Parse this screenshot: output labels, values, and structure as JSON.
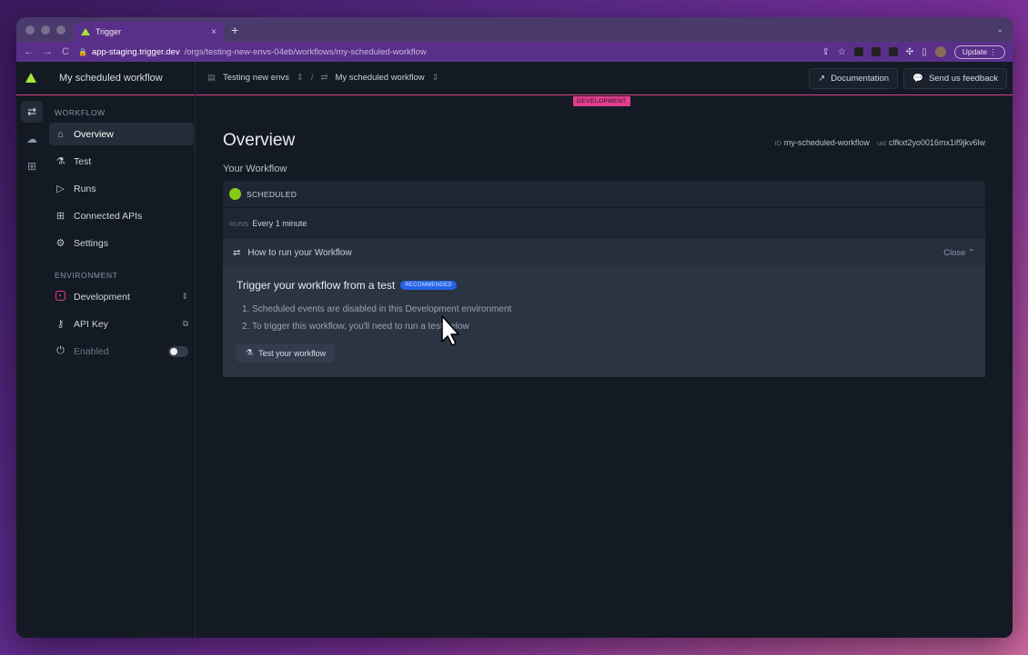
{
  "browser": {
    "tab_title": "Trigger",
    "tab_close": "×",
    "new_tab": "+",
    "url_domain": "app-staging.trigger.dev",
    "url_path": "/orgs/testing-new-envs-04eb/workflows/my-scheduled-workflow",
    "update_label": "Update",
    "nav_back": "←",
    "nav_forward": "→",
    "nav_reload": "C"
  },
  "app": {
    "title": "My scheduled workflow",
    "breadcrumbs": {
      "org": "Testing new envs",
      "workflow": "My scheduled workflow"
    },
    "actions": {
      "documentation": "Documentation",
      "feedback": "Send us feedback"
    },
    "env_badge": "DEVELOPMENT"
  },
  "sidebar": {
    "workflow_section": "WORKFLOW",
    "items": [
      {
        "label": "Overview",
        "icon": "home-icon"
      },
      {
        "label": "Test",
        "icon": "flask-icon"
      },
      {
        "label": "Runs",
        "icon": "runs-icon"
      },
      {
        "label": "Connected APIs",
        "icon": "grid-icon"
      },
      {
        "label": "Settings",
        "icon": "gear-icon"
      }
    ],
    "environment_section": "ENVIRONMENT",
    "environment": "Development",
    "api_key": "API Key",
    "enabled": "Enabled"
  },
  "main": {
    "title": "Overview",
    "id_label": "ID",
    "id_value": "my-scheduled-workflow",
    "uid_label": "uid",
    "uid_value": "clfkxt2yo0016mx1if9jkv6lw",
    "your_workflow": "Your Workflow",
    "status": "SCHEDULED",
    "runs_label": "RUNS",
    "runs_value": "Every 1 minute",
    "howto_title": "How to run your Workflow",
    "howto_close": "Close",
    "trigger_title": "Trigger your workflow from a test",
    "recommended": "RECOMMENDED",
    "steps": [
      "1. Scheduled events are disabled in this Development environment",
      "2. To trigger this workflow, you'll need to run a test below"
    ],
    "test_button": "Test your workflow"
  },
  "colors": {
    "accent_green": "#a3e635",
    "dev_pink": "#e23e8c",
    "recommended_blue": "#2563eb",
    "scheduled_green": "#84cc16"
  }
}
